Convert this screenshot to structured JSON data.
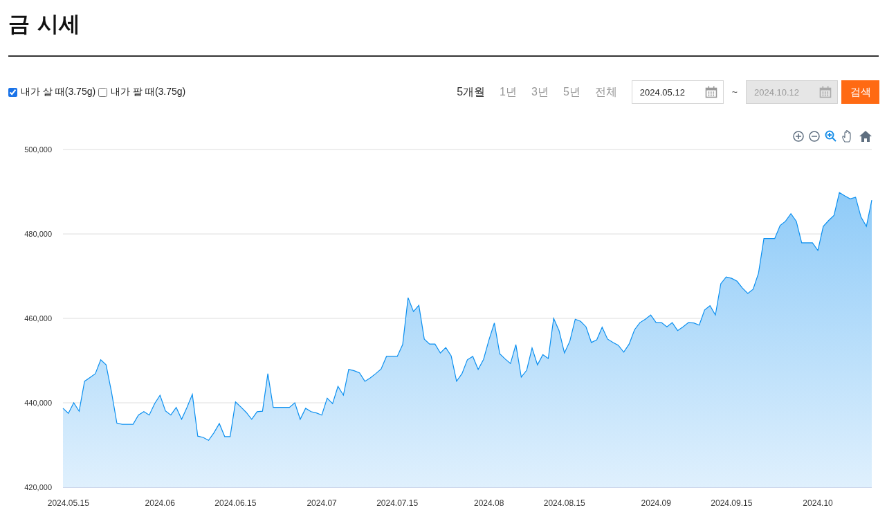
{
  "title": "금 시세",
  "filters": [
    {
      "label": "내가 살 때(3.75g)",
      "checked": true
    },
    {
      "label": "내가 팔 때(3.75g)",
      "checked": false
    }
  ],
  "periods": [
    {
      "label": "5개월",
      "selected": true
    },
    {
      "label": "1년",
      "selected": false
    },
    {
      "label": "3년",
      "selected": false
    },
    {
      "label": "5년",
      "selected": false
    },
    {
      "label": "전체",
      "selected": false
    }
  ],
  "date_range": {
    "start": {
      "value": "2024.05.12",
      "disabled": false
    },
    "separator": "~",
    "end": {
      "value": "2024.10.12",
      "disabled": true
    }
  },
  "search_button": "검색",
  "chart_tools": [
    {
      "kind": "zoom-in",
      "selected": false
    },
    {
      "kind": "zoom-out",
      "selected": false
    },
    {
      "kind": "selection-zoom",
      "selected": true
    },
    {
      "kind": "pan",
      "selected": false
    },
    {
      "kind": "reset",
      "selected": false
    }
  ],
  "chart": {
    "chart_data": {
      "type": "area",
      "categories": [
        null,
        "2024.05.15",
        null,
        null,
        null,
        null,
        null,
        null,
        null,
        null,
        null,
        null,
        null,
        null,
        null,
        null,
        null,
        null,
        "2024.06",
        null,
        null,
        null,
        null,
        null,
        null,
        null,
        null,
        null,
        null,
        null,
        null,
        null,
        "2024.06.15",
        null,
        null,
        null,
        null,
        null,
        null,
        null,
        null,
        null,
        null,
        null,
        null,
        null,
        null,
        null,
        "2024.07",
        null,
        null,
        null,
        null,
        null,
        null,
        null,
        null,
        null,
        null,
        null,
        null,
        null,
        "2024.07.15",
        null,
        null,
        null,
        null,
        null,
        null,
        null,
        null,
        null,
        null,
        null,
        null,
        null,
        null,
        null,
        null,
        "2024.08",
        null,
        null,
        null,
        null,
        null,
        null,
        null,
        null,
        null,
        null,
        null,
        null,
        null,
        "2024.08.15",
        null,
        null,
        null,
        null,
        null,
        null,
        null,
        null,
        null,
        null,
        null,
        null,
        null,
        null,
        null,
        null,
        "2024.09",
        null,
        null,
        null,
        null,
        null,
        null,
        null,
        null,
        null,
        null,
        null,
        null,
        null,
        "2024.09.15",
        null,
        null,
        null,
        null,
        null,
        null,
        null,
        null,
        null,
        null,
        null,
        null,
        null,
        null,
        null,
        "2024.10",
        null,
        null,
        null,
        null,
        null,
        null,
        null,
        null,
        null,
        null
      ],
      "series": [
        {
          "color": "#0a8ff0",
          "values": [
            438700,
            437500,
            440000,
            438000,
            445100,
            446000,
            446900,
            450200,
            449000,
            442600,
            435200,
            434900,
            434900,
            434900,
            437100,
            437900,
            437100,
            439800,
            441800,
            438100,
            437100,
            438900,
            436100,
            438900,
            442000,
            432100,
            431800,
            431100,
            432900,
            435100,
            432000,
            432000,
            440200,
            439000,
            437700,
            436100,
            437900,
            438000,
            446900,
            438900,
            438900,
            438900,
            438900,
            440000,
            436100,
            438700,
            437900,
            437600,
            437100,
            441100,
            439800,
            443900,
            441800,
            447900,
            447600,
            447100,
            445100,
            445900,
            446900,
            448000,
            451000,
            451000,
            451000,
            453800,
            464900,
            461600,
            463100,
            455100,
            453900,
            453900,
            451800,
            453100,
            451100,
            445100,
            446900,
            450200,
            451000,
            447900,
            450300,
            454900,
            458900,
            451600,
            450400,
            449300,
            453800,
            446100,
            447700,
            453000,
            449000,
            451400,
            450500,
            460000,
            457100,
            451800,
            454600,
            459800,
            459300,
            458000,
            454300,
            454900,
            457900,
            455100,
            454300,
            453600,
            452000,
            453900,
            457300,
            459000,
            459800,
            460800,
            459000,
            459000,
            458000,
            459000,
            457100,
            458000,
            459000,
            458900,
            458400,
            462000,
            463000,
            460800,
            468200,
            469800,
            469500,
            468800,
            467200,
            465900,
            466900,
            470700,
            478900,
            478900,
            478900,
            482000,
            483000,
            484800,
            483000,
            477900,
            477900,
            477900,
            476100,
            481800,
            483200,
            484400,
            489800,
            489000,
            488300,
            488700,
            484000,
            481800,
            488000
          ]
        }
      ],
      "grid": true,
      "ylim": [
        420000,
        500000
      ],
      "yticks": [
        {
          "value": 420000,
          "label": "420,000"
        },
        {
          "value": 440000,
          "label": "440,000"
        },
        {
          "value": 460000,
          "label": "460,000"
        },
        {
          "value": 480000,
          "label": "480,000"
        },
        {
          "value": 500000,
          "label": "500,000"
        }
      ]
    }
  }
}
